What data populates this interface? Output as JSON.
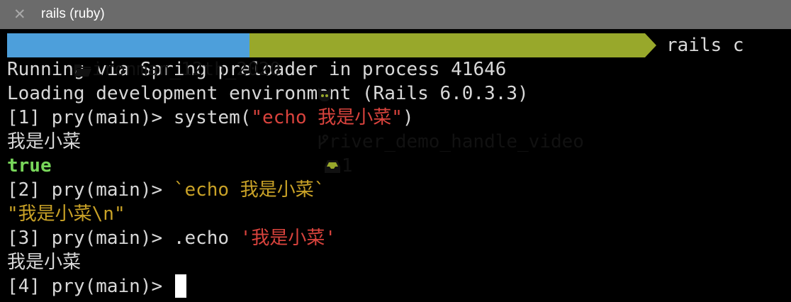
{
  "tab": {
    "close_glyph": "✕",
    "title": "rails (ruby)"
  },
  "prompt": {
    "dir": "ironman_12th_2020",
    "branch": "river_demo_handle_video",
    "stash_count": "1",
    "command": "rails c",
    "icons": [
      "folder-icon",
      "github-icon",
      "branch-icon",
      "inbox-icon"
    ]
  },
  "lines": {
    "l1": "Running via Spring preloader in process 41646",
    "l2": "Loading development environment (Rails 6.0.3.3)",
    "p1": "[1] pry(main)> ",
    "c1a": "system(",
    "c1b": "\"echo 我是小菜\"",
    "c1c": ")",
    "o1": "我是小菜",
    "o2": "true",
    "p2": "[2] pry(main)> ",
    "c2": "`echo 我是小菜`",
    "o3": "\"我是小菜\\n\"",
    "p3": "[3] pry(main)> ",
    "c3a": ".echo ",
    "c3b": "'我是小菜'",
    "o4": "我是小菜",
    "p4": "[4] pry(main)> "
  },
  "colors": {
    "background": "#000000",
    "tabbar": "#6b6b6b",
    "dir_segment": "#4d9fdb",
    "git_segment": "#98a82b",
    "string_red": "#d9433d",
    "string_yellow": "#c9a227",
    "true_green": "#78d65a"
  }
}
